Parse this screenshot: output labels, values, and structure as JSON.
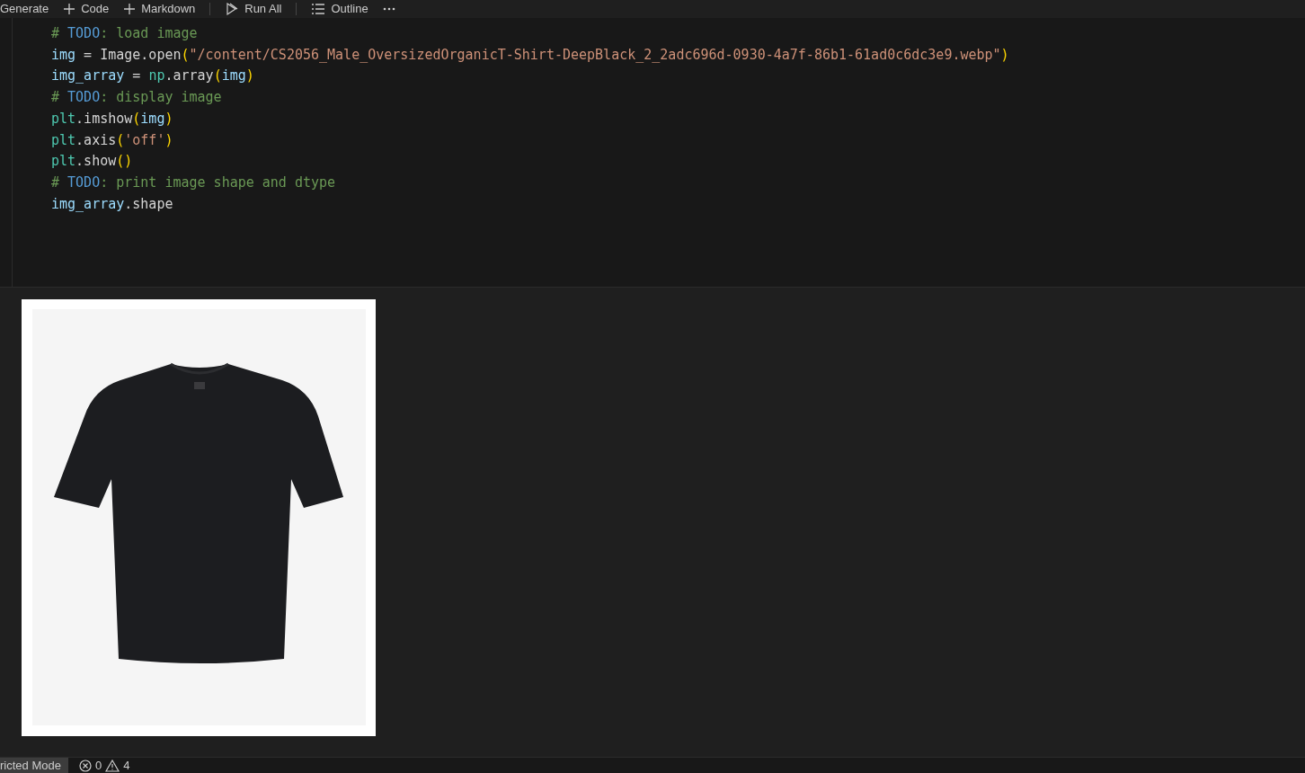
{
  "toolbar": [
    {
      "kind": "text",
      "label": "Generate"
    },
    {
      "kind": "add",
      "label": "Code"
    },
    {
      "kind": "add",
      "label": "Markdown"
    },
    {
      "kind": "run",
      "label": "Run All"
    },
    {
      "kind": "outline",
      "label": "Outline"
    },
    {
      "kind": "more"
    }
  ],
  "code_lines": [
    [
      {
        "kind": "comment",
        "text": "# "
      },
      {
        "kind": "todo",
        "text": "TODO"
      },
      {
        "kind": "comment",
        "text": ": load image"
      }
    ],
    [
      {
        "kind": "variable",
        "text": "img"
      },
      {
        "kind": "plain",
        "text": " = Image.open"
      },
      {
        "kind": "bracket",
        "text": "("
      },
      {
        "kind": "string",
        "text": "\"/content/CS2056_Male_OversizedOrganicT-Shirt-DeepBlack_2_2adc696d-0930-4a7f-86b1-61ad0c6dc3e9.webp\""
      },
      {
        "kind": "bracket",
        "text": ")"
      }
    ],
    [
      {
        "kind": "variable",
        "text": "img_array"
      },
      {
        "kind": "plain",
        "text": " = "
      },
      {
        "kind": "module",
        "text": "np"
      },
      {
        "kind": "plain",
        "text": ".array"
      },
      {
        "kind": "bracket",
        "text": "("
      },
      {
        "kind": "variable",
        "text": "img"
      },
      {
        "kind": "bracket",
        "text": ")"
      }
    ],
    [
      {
        "kind": "comment",
        "text": "# "
      },
      {
        "kind": "todo",
        "text": "TODO"
      },
      {
        "kind": "comment",
        "text": ": display image"
      }
    ],
    [
      {
        "kind": "module",
        "text": "plt"
      },
      {
        "kind": "plain",
        "text": ".imshow"
      },
      {
        "kind": "bracket",
        "text": "("
      },
      {
        "kind": "variable",
        "text": "img"
      },
      {
        "kind": "bracket",
        "text": ")"
      }
    ],
    [
      {
        "kind": "module",
        "text": "plt"
      },
      {
        "kind": "plain",
        "text": ".axis"
      },
      {
        "kind": "bracket",
        "text": "("
      },
      {
        "kind": "string",
        "text": "'off'"
      },
      {
        "kind": "bracket",
        "text": ")"
      }
    ],
    [
      {
        "kind": "module",
        "text": "plt"
      },
      {
        "kind": "plain",
        "text": ".show"
      },
      {
        "kind": "bracket",
        "text": "()"
      }
    ],
    [
      {
        "kind": "comment",
        "text": "# "
      },
      {
        "kind": "todo",
        "text": "TODO"
      },
      {
        "kind": "comment",
        "text": ": print image shape and dtype"
      }
    ],
    [
      {
        "kind": "variable",
        "text": "img_array"
      },
      {
        "kind": "plain",
        "text": ".shape"
      }
    ]
  ],
  "output": {
    "kind": "picture"
  },
  "status_bar": {
    "mode": "ricted Mode",
    "errors": "0",
    "warnings": "4"
  }
}
